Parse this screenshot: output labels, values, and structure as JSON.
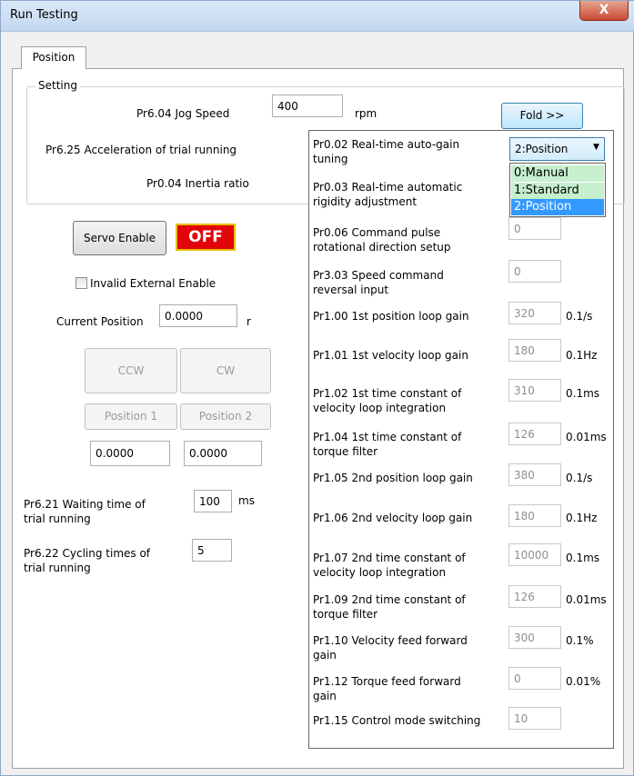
{
  "window": {
    "title": "Run Testing",
    "close_label": "X"
  },
  "tabs": [
    {
      "label": "Position"
    }
  ],
  "setting": {
    "legend": "Setting",
    "jog_speed_label": "Pr6.04 Jog Speed",
    "jog_speed_value": "400",
    "jog_speed_unit": "rpm",
    "accel_label": "Pr6.25 Acceleration of trial running",
    "inertia_label": "Pr0.04 Inertia ratio",
    "fold_label": "Fold >>"
  },
  "servo": {
    "enable_label": "Servo Enable",
    "status": "OFF",
    "invalid_external_label": "Invalid External Enable",
    "current_position_label": "Current Position",
    "current_position_value": "0.0000",
    "current_position_unit": "r"
  },
  "jog": {
    "ccw_label": "CCW",
    "cw_label": "CW",
    "pos1_label": "Position 1",
    "pos2_label": "Position 2",
    "pos1_value": "0.0000",
    "pos2_value": "0.0000"
  },
  "trial": {
    "wait_label_1": "Pr6.21 Waiting time of",
    "wait_label_2": "trial running",
    "wait_value": "100",
    "wait_unit": "ms",
    "cycle_label_1": "Pr6.22 Cycling times of",
    "cycle_label_2": "trial running",
    "cycle_value": "5"
  },
  "gain": {
    "autogain_label_1": "Pr0.02 Real-time auto-gain",
    "autogain_label_2": "tuning",
    "autogain_selected": "2:Position",
    "autogain_options": [
      "0:Manual",
      "1:Standard",
      "2:Position"
    ],
    "rigidity_label_1": "Pr0.03 Real-time automatic",
    "rigidity_label_2": "rigidity adjustment",
    "params": [
      {
        "l1": "Pr0.06 Command pulse",
        "l2": "rotational direction setup",
        "value": "0",
        "unit": ""
      },
      {
        "l1": "Pr3.03 Speed command",
        "l2": "reversal input",
        "value": "0",
        "unit": ""
      },
      {
        "l1": "Pr1.00 1st position loop gain",
        "l2": "",
        "value": "320",
        "unit": "0.1/s"
      },
      {
        "l1": "Pr1.01 1st velocity loop gain",
        "l2": "",
        "value": "180",
        "unit": "0.1Hz"
      },
      {
        "l1": "Pr1.02 1st time constant of",
        "l2": "velocity loop integration",
        "value": "310",
        "unit": "0.1ms"
      },
      {
        "l1": "Pr1.04 1st time constant of",
        "l2": "torque filter",
        "value": "126",
        "unit": "0.01ms"
      },
      {
        "l1": "Pr1.05 2nd position loop gain",
        "l2": "",
        "value": "380",
        "unit": "0.1/s"
      },
      {
        "l1": "Pr1.06 2nd velocity loop gain",
        "l2": "",
        "value": "180",
        "unit": "0.1Hz"
      },
      {
        "l1": "Pr1.07 2nd time constant of",
        "l2": "velocity loop integration",
        "value": "10000",
        "unit": "0.1ms"
      },
      {
        "l1": "Pr1.09 2nd time constant of",
        "l2": "torque filter",
        "value": "126",
        "unit": "0.01ms"
      },
      {
        "l1": "Pr1.10 Velocity feed forward",
        "l2": "gain",
        "value": "300",
        "unit": "0.1%"
      },
      {
        "l1": "Pr1.12 Torque feed forward",
        "l2": "gain",
        "value": "0",
        "unit": "0.01%"
      },
      {
        "l1": "Pr1.15 Control mode switching",
        "l2": "",
        "value": "10",
        "unit": ""
      }
    ]
  }
}
